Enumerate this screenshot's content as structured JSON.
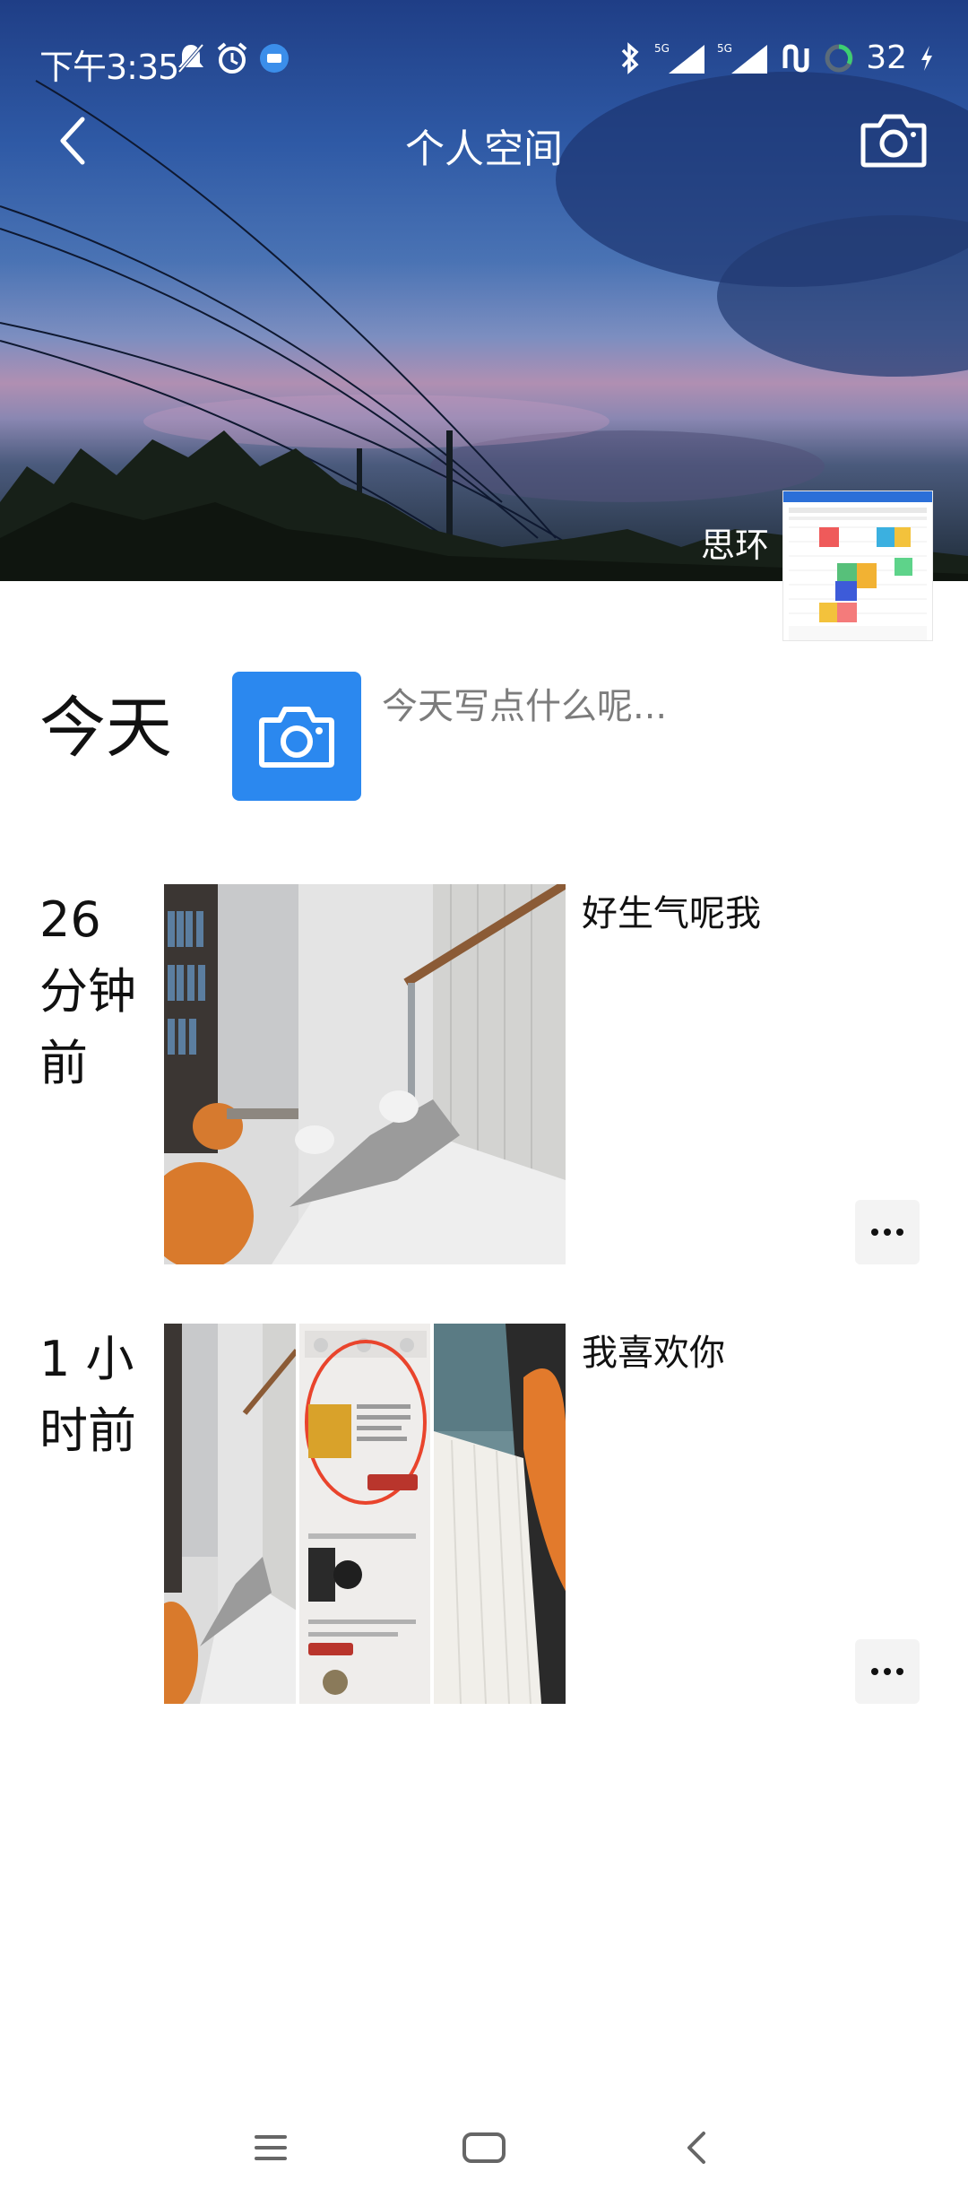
{
  "status_bar": {
    "time": "下午3:35",
    "battery": "32",
    "icons": [
      "mute-icon",
      "alarm-icon",
      "app-notification-icon",
      "bluetooth-icon",
      "signal-5g-icon",
      "signal-5g-icon",
      "sync-icon",
      "battery-ring-icon",
      "charging-icon"
    ],
    "network_badge": "5G"
  },
  "header": {
    "title": "个人空间",
    "back_icon": "back-icon",
    "camera_icon": "camera-icon"
  },
  "profile": {
    "nickname": "思环"
  },
  "today": {
    "label": "今天",
    "compose_placeholder": "今天写点什么呢..."
  },
  "posts": [
    {
      "time_label": "26\n分钟\n前",
      "caption": "好生气呢我",
      "image_count": 1
    },
    {
      "time_label": "1 小\n时前",
      "caption": "我喜欢你",
      "image_count": 3
    }
  ],
  "colors": {
    "accent": "#2b88ef",
    "placeholder": "#7c7c7c",
    "more_button_bg": "#f3f3f3"
  }
}
